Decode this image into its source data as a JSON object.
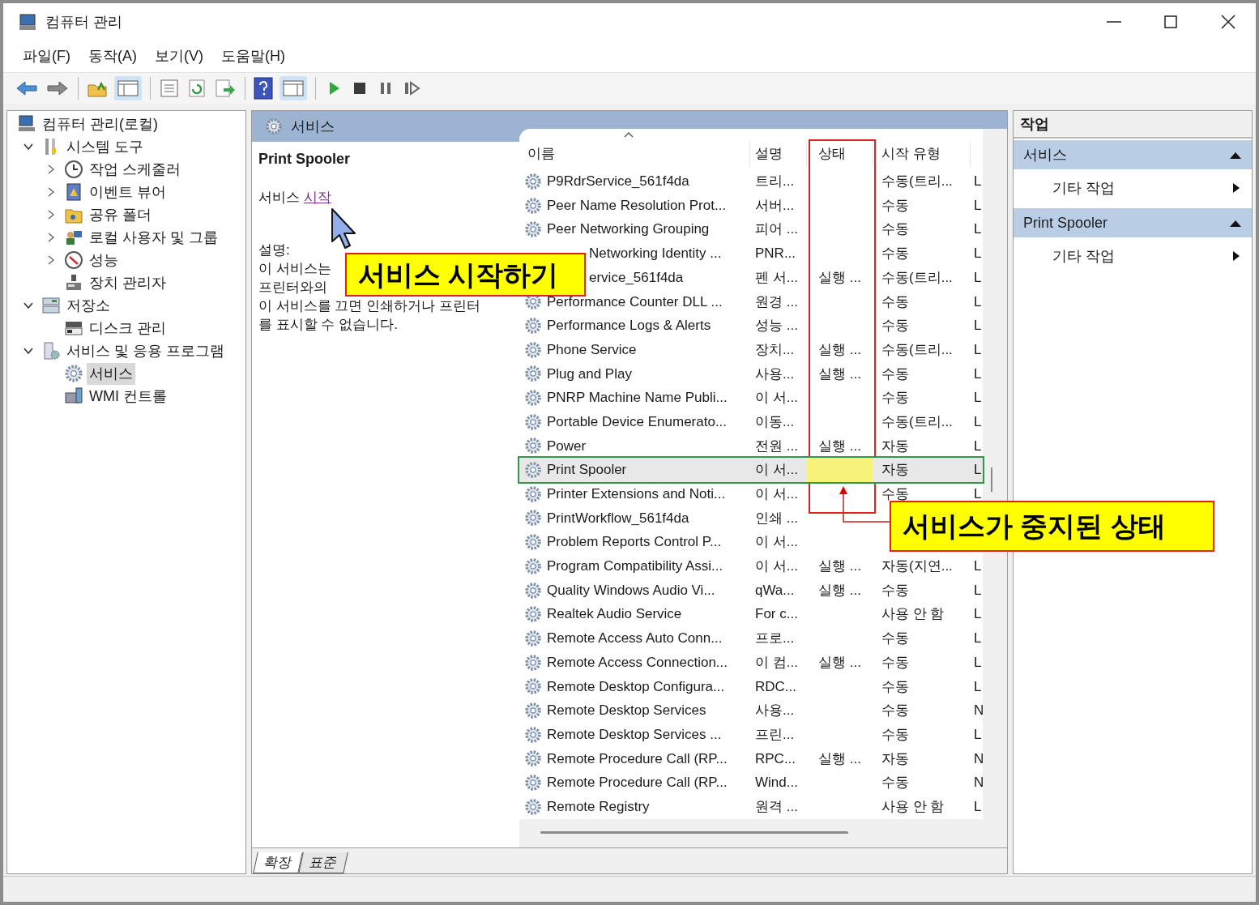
{
  "window": {
    "title": "컴퓨터 관리"
  },
  "menu": [
    "파일(F)",
    "동작(A)",
    "보기(V)",
    "도움말(H)"
  ],
  "tree": [
    {
      "label": "컴퓨터 관리(로컬)",
      "selected": false,
      "children": [
        {
          "label": "시스템 도구",
          "expanded": true,
          "selected": false,
          "children": [
            {
              "label": "작업 스케줄러",
              "expanded": false,
              "selected": false
            },
            {
              "label": "이벤트 뷰어",
              "expanded": false,
              "selected": false
            },
            {
              "label": "공유 폴더",
              "expanded": false,
              "selected": false
            },
            {
              "label": "로컬 사용자 및 그룹",
              "expanded": false,
              "selected": false
            },
            {
              "label": "성능",
              "expanded": false,
              "selected": false
            },
            {
              "label": "장치 관리자",
              "selected": false
            }
          ]
        },
        {
          "label": "저장소",
          "expanded": true,
          "selected": false,
          "children": [
            {
              "label": "디스크 관리",
              "selected": false
            }
          ]
        },
        {
          "label": "서비스 및 응용 프로그램",
          "expanded": true,
          "selected": false,
          "children": [
            {
              "label": "서비스",
              "selected": true
            },
            {
              "label": "WMI 컨트롤",
              "selected": false
            }
          ]
        }
      ]
    }
  ],
  "services_panel": {
    "title": "서비스",
    "detail": {
      "name": "Print Spooler",
      "action_prefix": "서비스",
      "action_link": "시작",
      "description_label": "설명:",
      "description_lines": [
        "이 서비스는",
        "프린터와의",
        "이 서비스를 끄면 인쇄하거나 프린터",
        "를 표시할 수 없습니다."
      ]
    },
    "columns": [
      {
        "label": "이름",
        "sorted": true
      },
      {
        "label": "설명"
      },
      {
        "label": "상태"
      },
      {
        "label": "시작 유형"
      }
    ],
    "rows": [
      {
        "kind": "full",
        "name": "P9RdrService_561f4da",
        "description": "트리...",
        "status": "",
        "startup": "수동(트리...",
        "logon": "L",
        "selected": false,
        "status_highlighted": false
      },
      {
        "kind": "full",
        "name": "Peer Name Resolution Prot...",
        "description": "서버...",
        "status": "",
        "startup": "수동",
        "logon": "L",
        "selected": false,
        "status_highlighted": false
      },
      {
        "kind": "full",
        "name": "Peer Networking Grouping",
        "description": "피어 ...",
        "status": "",
        "startup": "수동",
        "logon": "L",
        "selected": false,
        "status_highlighted": false
      },
      {
        "kind": "covered",
        "name": "Networking Identity ...",
        "description": "PNR...",
        "status": "",
        "startup": "수동",
        "logon": "L",
        "selected": false,
        "status_highlighted": false
      },
      {
        "kind": "covered",
        "name": "ervice_561f4da",
        "description": "펜 서...",
        "status": "실행 ...",
        "startup": "수동(트리...",
        "logon": "L",
        "selected": false,
        "status_highlighted": false
      },
      {
        "kind": "full",
        "name": "Performance Counter DLL ...",
        "description": "원경 ...",
        "status": "",
        "startup": "수동",
        "logon": "L",
        "selected": false,
        "status_highlighted": false
      },
      {
        "kind": "full",
        "name": "Performance Logs & Alerts",
        "description": "성능 ...",
        "status": "",
        "startup": "수동",
        "logon": "L",
        "selected": false,
        "status_highlighted": false
      },
      {
        "kind": "full",
        "name": "Phone Service",
        "description": "장치...",
        "status": "실행 ...",
        "startup": "수동(트리...",
        "logon": "L",
        "selected": false,
        "status_highlighted": false
      },
      {
        "kind": "full",
        "name": "Plug and Play",
        "description": "사용...",
        "status": "실행 ...",
        "startup": "수동",
        "logon": "L",
        "selected": false,
        "status_highlighted": false
      },
      {
        "kind": "full",
        "name": "PNRP Machine Name Publi...",
        "description": "이 서...",
        "status": "",
        "startup": "수동",
        "logon": "L",
        "selected": false,
        "status_highlighted": false
      },
      {
        "kind": "full",
        "name": "Portable Device Enumerato...",
        "description": "이동...",
        "status": "",
        "startup": "수동(트리...",
        "logon": "L",
        "selected": false,
        "status_highlighted": false
      },
      {
        "kind": "full",
        "name": "Power",
        "description": "전원 ...",
        "status": "실행 ...",
        "startup": "자동",
        "logon": "L",
        "selected": false,
        "status_highlighted": false
      },
      {
        "kind": "full",
        "name": "Print Spooler",
        "description": "이 서...",
        "status": "",
        "startup": "자동",
        "logon": "L",
        "selected": true,
        "status_highlighted": true
      },
      {
        "kind": "full",
        "name": "Printer Extensions and Noti...",
        "description": "이 서...",
        "status": "",
        "startup": "수동",
        "logon": "L",
        "selected": false,
        "status_highlighted": false
      },
      {
        "kind": "full",
        "name": "PrintWorkflow_561f4da",
        "description": "인쇄 ...",
        "status": "",
        "startup": "",
        "logon": "",
        "selected": false,
        "status_highlighted": false
      },
      {
        "kind": "full",
        "name": "Problem Reports Control P...",
        "description": "이 서...",
        "status": "",
        "startup": "",
        "logon": "",
        "selected": false,
        "status_highlighted": false
      },
      {
        "kind": "full",
        "name": "Program Compatibility Assi...",
        "description": "이 서...",
        "status": "실행 ...",
        "startup": "자동(지연...",
        "logon": "L",
        "selected": false,
        "status_highlighted": false
      },
      {
        "kind": "full",
        "name": "Quality Windows Audio Vi...",
        "description": "qWa...",
        "status": "실행 ...",
        "startup": "수동",
        "logon": "L",
        "selected": false,
        "status_highlighted": false
      },
      {
        "kind": "full",
        "name": "Realtek Audio Service",
        "description": "For c...",
        "status": "",
        "startup": "사용 안 함",
        "logon": "L",
        "selected": false,
        "status_highlighted": false
      },
      {
        "kind": "full",
        "name": "Remote Access Auto Conn...",
        "description": "프로...",
        "status": "",
        "startup": "수동",
        "logon": "L",
        "selected": false,
        "status_highlighted": false
      },
      {
        "kind": "full",
        "name": "Remote Access Connection...",
        "description": "이 컴...",
        "status": "실행 ...",
        "startup": "수동",
        "logon": "L",
        "selected": false,
        "status_highlighted": false
      },
      {
        "kind": "full",
        "name": "Remote Desktop Configura...",
        "description": "RDC...",
        "status": "",
        "startup": "수동",
        "logon": "L",
        "selected": false,
        "status_highlighted": false
      },
      {
        "kind": "full",
        "name": "Remote Desktop Services",
        "description": "사용...",
        "status": "",
        "startup": "수동",
        "logon": "N",
        "selected": false,
        "status_highlighted": false
      },
      {
        "kind": "full",
        "name": "Remote Desktop Services ...",
        "description": "프린...",
        "status": "",
        "startup": "수동",
        "logon": "L",
        "selected": false,
        "status_highlighted": false
      },
      {
        "kind": "full",
        "name": "Remote Procedure Call (RP...",
        "description": "RPC...",
        "status": "실행 ...",
        "startup": "자동",
        "logon": "N",
        "selected": false,
        "status_highlighted": false
      },
      {
        "kind": "full",
        "name": "Remote Procedure Call (RP...",
        "description": "Wind...",
        "status": "",
        "startup": "수동",
        "logon": "N",
        "selected": false,
        "status_highlighted": false
      },
      {
        "kind": "full",
        "name": "Remote Registry",
        "description": "원격 ...",
        "status": "",
        "startup": "사용 안 함",
        "logon": "L",
        "selected": false,
        "status_highlighted": false
      }
    ],
    "tabs": [
      {
        "label": "확장",
        "selected": true
      },
      {
        "label": "표준",
        "selected": false
      }
    ]
  },
  "actions": {
    "title": "작업",
    "sections": [
      {
        "title": "서비스",
        "expanded": true,
        "items": [
          "기타 작업"
        ]
      },
      {
        "title": "Print Spooler",
        "expanded": true,
        "items": [
          "기타 작업"
        ]
      }
    ]
  },
  "annotations": [
    {
      "text": "서비스 시작하기"
    },
    {
      "text": "서비스가 중지된 상태"
    }
  ]
}
